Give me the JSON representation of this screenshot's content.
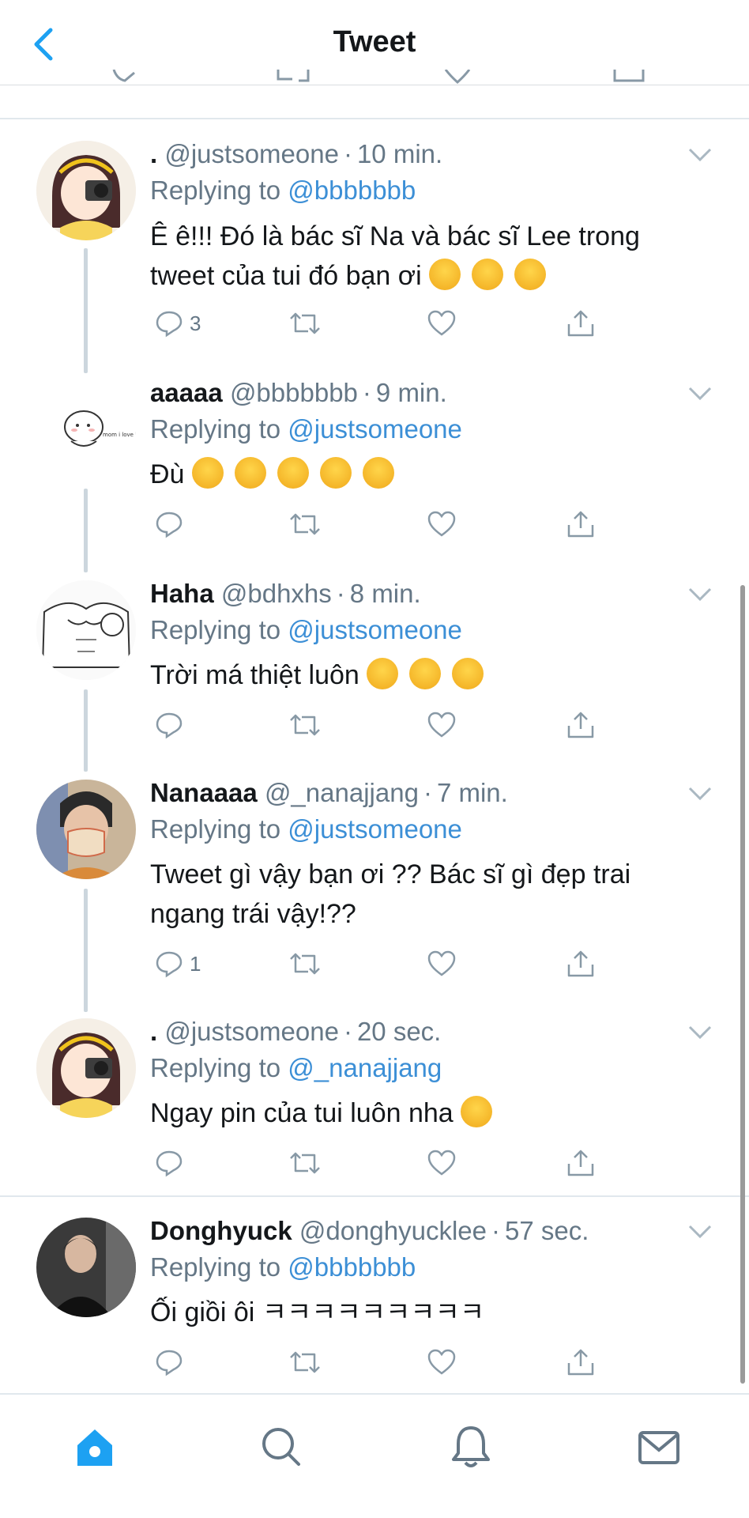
{
  "header": {
    "title": "Tweet"
  },
  "tweets": [
    {
      "name": ".",
      "handle": "@justsomeone",
      "time": "10 min.",
      "replying_prefix": "Replying to",
      "replying_to": "@bbbbbbb",
      "text": "Ê ê!!! Đó là bác sĩ Na và bác sĩ Lee trong tweet của tui đó bạn ơi",
      "emoji": [
        "scream-emoji",
        "scream-emoji",
        "scream-emoji"
      ],
      "reply_count": "3",
      "avatar": "anime-girl-camera-avatar"
    },
    {
      "name": "aaaaa",
      "handle": "@bbbbbbb",
      "time": "9 min.",
      "replying_prefix": "Replying to",
      "replying_to": "@justsomeone",
      "text": "Đù",
      "emoji": [
        "woozy-face-emoji",
        "woozy-face-emoji",
        "woozy-face-emoji",
        "woozy-face-emoji",
        "woozy-face-emoji"
      ],
      "reply_count": "",
      "avatar_caption": "mom i love him",
      "avatar": "cartoon-blob-avatar"
    },
    {
      "name": "Haha",
      "handle": "@bdhxhs",
      "time": "8 min.",
      "replying_prefix": "Replying to",
      "replying_to": "@justsomeone",
      "text": "Trời má thiệt luôn",
      "emoji": [
        "woozy-face-emoji",
        "woozy-face-emoji",
        "woozy-face-emoji"
      ],
      "reply_count": "",
      "avatar": "sketch-torso-avatar"
    },
    {
      "name": "Nanaaaa",
      "handle": "@_nanajjang",
      "time": "7 min.",
      "replying_prefix": "Replying to",
      "replying_to": "@justsomeone",
      "text": "Tweet gì vậy bạn ơi ?? Bác sĩ gì đẹp trai ngang trái vậy!??",
      "emoji": [],
      "reply_count": "1",
      "avatar": "photo-person-avatar"
    },
    {
      "name": ".",
      "handle": "@justsomeone",
      "time": "20 sec.",
      "replying_prefix": "Replying to",
      "replying_to": "@_nanajjang",
      "text": "Ngay pin của tui luôn nha",
      "emoji": [
        "kissing-heart-emoji"
      ],
      "reply_count": "",
      "avatar": "anime-girl-camera-avatar"
    },
    {
      "name": "Donghyuck",
      "handle": "@donghyucklee",
      "time": "57 sec.",
      "replying_prefix": "Replying to",
      "replying_to": "@bbbbbbb",
      "text": "Ối giồi ôi ㅋㅋㅋㅋㅋㅋㅋㅋㅋ",
      "emoji": [],
      "reply_count": "",
      "avatar": "photo-dark-avatar"
    }
  ],
  "bottom_nav": [
    "home-icon",
    "search-icon",
    "notifications-icon",
    "messages-icon"
  ],
  "colors": {
    "accent": "#1da1f2",
    "link": "#3c8fd6",
    "muted": "#657786",
    "icon": "#8899a6"
  }
}
